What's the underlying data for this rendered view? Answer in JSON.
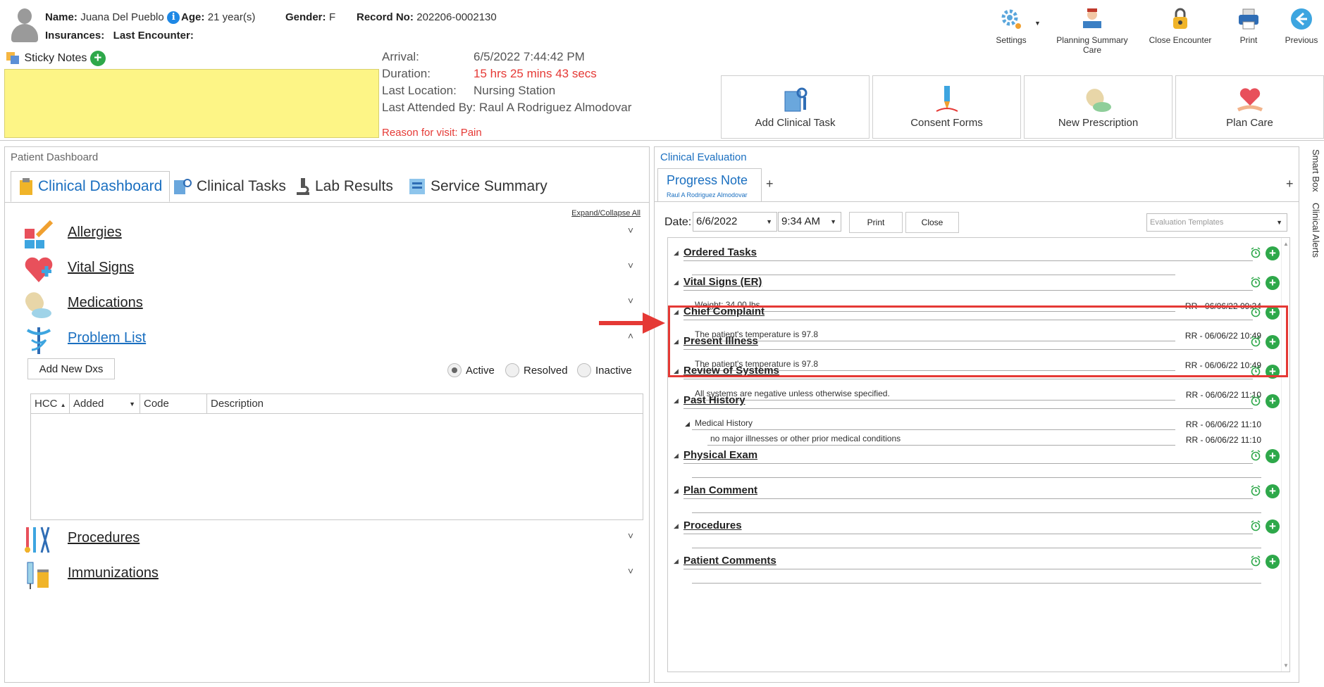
{
  "patient": {
    "name_label": "Name:",
    "name": "Juana Del Pueblo",
    "info_icon": "i",
    "age_label": "Age:",
    "age": "21 year(s)",
    "gender_label": "Gender:",
    "gender": "F",
    "record_label": "Record No:",
    "record": "202206-0002130",
    "insurances_label": "Insurances:",
    "last_encounter_label": "Last Encounter:"
  },
  "toolbar": {
    "settings": "Settings",
    "planning": "Planning Summary Care",
    "close_encounter": "Close Encounter",
    "print": "Print",
    "previous": "Previous"
  },
  "sticky": {
    "label": "Sticky Notes",
    "plus": "+"
  },
  "encounter": {
    "arrival_label": "Arrival:",
    "arrival": "6/5/2022 7:44:42 PM",
    "duration_label": "Duration:",
    "duration": "15 hrs 25 mins 43 secs",
    "location_label": "Last Location:",
    "location": "Nursing Station",
    "attended_label": "Last Attended By:",
    "attended": "Raul A Rodriguez Almodovar",
    "reason": "Reason for visit: Pain",
    "duration_color": "#e53935"
  },
  "actions": {
    "add_task": "Add Clinical Task",
    "consent": "Consent Forms",
    "prescription": "New Prescription",
    "plan_care": "Plan Care"
  },
  "left": {
    "caption": "Patient Dashboard",
    "tabs": [
      "Clinical Dashboard",
      "Clinical Tasks",
      "Lab Results",
      "Service Summary"
    ],
    "expand_collapse": "Expand/Collapse All",
    "sections": {
      "allergies": "Allergies",
      "vitals": "Vital Signs",
      "medications": "Medications",
      "problem_list": "Problem List",
      "procedures": "Procedures",
      "immunizations": "Immunizations"
    },
    "add_dx": "Add New Dxs",
    "filters": [
      "Active",
      "Resolved",
      "Inactive"
    ],
    "grid_columns": [
      "HCC",
      "Added",
      "Code",
      "Description"
    ],
    "chev_down": "˅",
    "chev_up": "˄"
  },
  "right": {
    "caption": "Clinical Evaluation",
    "tab_title": "Progress Note",
    "tab_author": "Raul A Rodriguez Almodovar",
    "plus": "+",
    "date_label": "Date:",
    "date": "6/6/2022",
    "time": "9:34 AM",
    "print": "Print",
    "close": "Close",
    "templates_placeholder": "Evaluation Templates",
    "sections": {
      "ordered_tasks": "Ordered Tasks",
      "vital_signs": "Vital Signs (ER)",
      "chief_complaint": "Chief Complaint",
      "present_illness": "Present Illness",
      "review_systems": "Review of Systems",
      "past_history": "Past History",
      "physical_exam": "Physical Exam",
      "plan_comment": "Plan Comment",
      "procedures": "Procedures",
      "patient_comments": "Patient Comments"
    },
    "entries": {
      "weight": "Weight: 34.00 lbs.",
      "weight_stamp": "RR - 06/06/22 09:34",
      "chief": "The patient's temperature is 97.8",
      "chief_stamp": "RR - 06/06/22 10:49",
      "illness": "The patient's temperature is 97.8",
      "illness_stamp": "RR - 06/06/22 10:49",
      "ros": "All systems are negative unless otherwise specified.",
      "ros_stamp": "RR - 06/06/22 11:10",
      "medical_history": "Medical History",
      "medical_history_stamp": "RR - 06/06/22 11:10",
      "mh_detail": "no major illnesses or other prior medical conditions",
      "mh_detail_stamp": "RR - 06/06/22 11:10"
    }
  },
  "side_tabs": [
    "Smart Box",
    "Clinical Alerts"
  ],
  "colors": {
    "accent_blue": "#1a6fc0",
    "add_green": "#2ea84a",
    "highlight_red": "#e53935",
    "sticky_yellow": "#fdf586"
  }
}
